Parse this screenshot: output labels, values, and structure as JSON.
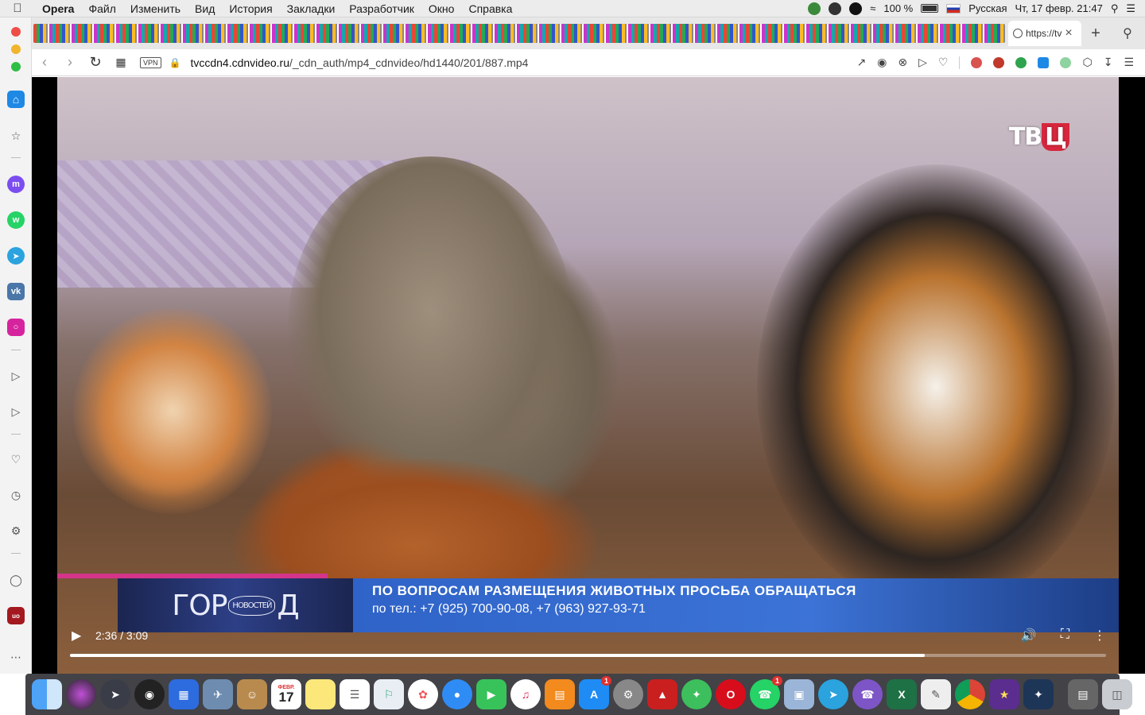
{
  "menubar": {
    "app_name": "Opera",
    "items": [
      "Файл",
      "Изменить",
      "Вид",
      "История",
      "Закладки",
      "Разработчик",
      "Окно",
      "Справка"
    ],
    "battery": "100 %",
    "input_source": "Русская",
    "datetime": "Чт, 17 февр.  21:47"
  },
  "tabs": {
    "active_tab_title": "https://tv",
    "new_tab_symbol": "+",
    "close_symbol": "×"
  },
  "address": {
    "vpn_label": "VPN",
    "url_host": "tvccdn4.cdnvideo.ru",
    "url_path": "/_cdn_auth/mp4_cdnvideo/hd1440/201/887.mp4"
  },
  "video": {
    "watermark_prefix": "ТВ",
    "watermark_suffix": "Ц",
    "show_logo_left": "ГОР",
    "show_logo_center": "НОВОСТЕЙ",
    "show_logo_right": "Д",
    "caption_line1": "ПО ВОПРОСАМ РАЗМЕЩЕНИЯ ЖИВОТНЫХ ПРОСЬБА ОБРАЩАТЬСЯ",
    "caption_line2": "по тел.: +7 (925) 700-90-08, +7 (963) 927-93-71"
  },
  "player": {
    "time": "2:36 / 3:09",
    "progress_fraction": 0.825
  },
  "dock": {
    "calendar_month": "ФЕВР.",
    "calendar_day": "17",
    "appstore_badge": "1",
    "whatsapp_badge": "1"
  },
  "colors": {
    "accent_blue": "#2f63c8",
    "menu_bg": "#ececec",
    "tv_red": "#d7263d"
  }
}
